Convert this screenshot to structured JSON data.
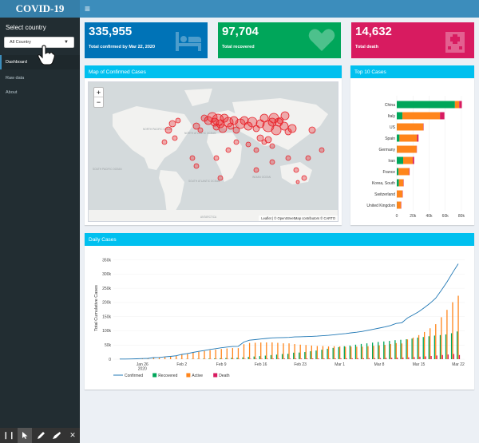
{
  "app": {
    "title": "COVID-19"
  },
  "header": {
    "menu_icon": "hamburger-icon"
  },
  "sidebar": {
    "select_label": "Select country",
    "select_value": "All Country",
    "items": [
      {
        "label": "Dashboard",
        "active": true
      },
      {
        "label": "Raw data",
        "active": false
      },
      {
        "label": "About",
        "active": false
      }
    ]
  },
  "value_boxes": [
    {
      "value": "335,955",
      "label": "Total confirmed by Mar 22, 2020",
      "color": "#0073b7",
      "icon": "bed-icon"
    },
    {
      "value": "97,704",
      "label": "Total recovered",
      "color": "#00a65a",
      "icon": "heart-icon"
    },
    {
      "value": "14,632",
      "label": "Total death",
      "color": "#d81b60",
      "icon": "hospital-icon"
    }
  ],
  "map_box": {
    "title": "Map of Confirmed Cases",
    "zoom_in": "+",
    "zoom_out": "−",
    "attribution": "Leaflet | © OpenStreetMap contributors © CARTO",
    "labels": [
      "NORTH PACIFIC OCEAN",
      "NORTH ATLANTIC OCEAN",
      "SOUTH PACIFIC OCEAN",
      "SOUTH ATLANTIC OCEAN",
      "INDIAN OCEAN",
      "ANTARCTICA"
    ]
  },
  "top10_box": {
    "title": "Top 10 Cases"
  },
  "daily_box": {
    "title": "Daily Cases"
  },
  "colors": {
    "recovered": "#00a65a",
    "active": "#ff851b",
    "death": "#d81b60",
    "confirmed": "#1f77b4",
    "accent": "#00c0ef"
  },
  "chart_data": [
    {
      "type": "bar",
      "stacked": true,
      "orientation": "horizontal",
      "categories": [
        "China",
        "Italy",
        "US",
        "Spain",
        "Germany",
        "Iran",
        "France",
        "Korea, South",
        "Switzerland",
        "United Kingdom"
      ],
      "series": [
        {
          "name": "Recovered",
          "values": [
            72000,
            7000,
            170,
            3350,
            180,
            7900,
            2200,
            2600,
            15,
            140
          ]
        },
        {
          "name": "Active",
          "values": [
            5300,
            46500,
            32700,
            21800,
            24300,
            11900,
            13000,
            5600,
            7000,
            5100
          ]
        },
        {
          "name": "Death",
          "values": [
            3260,
            5500,
            420,
            1750,
            90,
            1700,
            680,
            100,
            100,
            280
          ]
        }
      ],
      "xticks": [
        "0",
        "20k",
        "40k",
        "60k",
        "80k"
      ],
      "xlim": [
        0,
        85000
      ]
    },
    {
      "type": "line",
      "title": "",
      "ylabel": "Total Cumulative Cases",
      "xticks": [
        "Jan 26\n2020",
        "Feb 2",
        "Feb 9",
        "Feb 16",
        "Feb 23",
        "Mar 1",
        "Mar 8",
        "Mar 15",
        "Mar 22"
      ],
      "yticks": [
        "0",
        "50k",
        "100k",
        "150k",
        "200k",
        "250k",
        "300k",
        "350k"
      ],
      "ylim": [
        0,
        360000
      ],
      "x": [
        "Jan 22",
        "Jan 23",
        "Jan 24",
        "Jan 25",
        "Jan 26",
        "Jan 27",
        "Jan 28",
        "Jan 29",
        "Jan 30",
        "Jan 31",
        "Feb 1",
        "Feb 2",
        "Feb 3",
        "Feb 4",
        "Feb 5",
        "Feb 6",
        "Feb 7",
        "Feb 8",
        "Feb 9",
        "Feb 10",
        "Feb 11",
        "Feb 12",
        "Feb 13",
        "Feb 14",
        "Feb 15",
        "Feb 16",
        "Feb 17",
        "Feb 18",
        "Feb 19",
        "Feb 20",
        "Feb 21",
        "Feb 22",
        "Feb 23",
        "Feb 24",
        "Feb 25",
        "Feb 26",
        "Feb 27",
        "Feb 28",
        "Feb 29",
        "Mar 1",
        "Mar 2",
        "Mar 3",
        "Mar 4",
        "Mar 5",
        "Mar 6",
        "Mar 7",
        "Mar 8",
        "Mar 9",
        "Mar 10",
        "Mar 11",
        "Mar 12",
        "Mar 13",
        "Mar 14",
        "Mar 15",
        "Mar 16",
        "Mar 17",
        "Mar 18",
        "Mar 19",
        "Mar 20",
        "Mar 21",
        "Mar 22"
      ],
      "series": [
        {
          "name": "Confirmed",
          "values": [
            555,
            654,
            941,
            1434,
            2118,
            2927,
            5578,
            6166,
            8234,
            9927,
            12038,
            16787,
            19881,
            23892,
            27635,
            30794,
            34391,
            37120,
            40150,
            42762,
            44802,
            45221,
            60368,
            66885,
            69030,
            71224,
            73258,
            75136,
            75639,
            76197,
            76819,
            78572,
            78958,
            79561,
            80406,
            81388,
            82746,
            84112,
            86011,
            88369,
            90306,
            92840,
            95120,
            97886,
            101801,
            105847,
            109821,
            113590,
            118620,
            125875,
            128352,
            145205,
            156101,
            167454,
            181574,
            197102,
            214821,
            242570,
            272208,
            304507,
            335955
          ]
        },
        {
          "name": "Recovered",
          "values": [
            28,
            30,
            36,
            39,
            52,
            61,
            107,
            126,
            143,
            222,
            284,
            472,
            623,
            852,
            1124,
            1487,
            2011,
            2616,
            3244,
            3946,
            4683,
            5150,
            6295,
            8058,
            9395,
            10865,
            12583,
            14352,
            16121,
            18177,
            18890,
            22886,
            23394,
            25227,
            27905,
            30384,
            33277,
            36711,
            39782,
            42716,
            45602,
            48228,
            51170,
            53796,
            55865,
            58358,
            60694,
            62494,
            64404,
            67003,
            68324,
            70251,
            72624,
            76034,
            78088,
            80840,
            83207,
            84854,
            87256,
            91499,
            97704
          ]
        },
        {
          "name": "Active",
          "values": [
            510,
            605,
            879,
            1353,
            2010,
            2784,
            5340,
            5908,
            7920,
            9492,
            11495,
            16003,
            18834,
            22494,
            26002,
            28760,
            31732,
            33835,
            36064,
            37896,
            39185,
            38996,
            52706,
            57234,
            57969,
            58726,
            59064,
            59104,
            57573,
            55892,
            55722,
            53272,
            51212,
            49863,
            48100,
            46473,
            46546,
            44965,
            45711,
            45006,
            44228,
            44430,
            44028,
            44231,
            45773,
            47153,
            48694,
            50464,
            53304,
            56624,
            55453,
            69778,
            76151,
            84853,
            95824,
            108949,
            123493,
            147929,
            173874,
            200815,
            223619
          ]
        },
        {
          "name": "Death",
          "values": [
            17,
            18,
            26,
            42,
            56,
            82,
            131,
            133,
            171,
            213,
            259,
            362,
            426,
            492,
            564,
            634,
            719,
            806,
            906,
            1013,
            1113,
            1118,
            1371,
            1523,
            1666,
            1770,
            1868,
            2007,
            2122,
            2247,
            2251,
            2458,
            2469,
            2629,
            2708,
            2770,
            2814,
            2872,
            2941,
            2996,
            3085,
            3160,
            3254,
            3348,
            3460,
            3558,
            3802,
            4393,
            4951,
            5404,
            5819,
            6440,
            7126,
            8733,
            9867,
            11299,
            12973,
            14651,
            16497,
            18442,
            14632
          ]
        }
      ]
    }
  ]
}
